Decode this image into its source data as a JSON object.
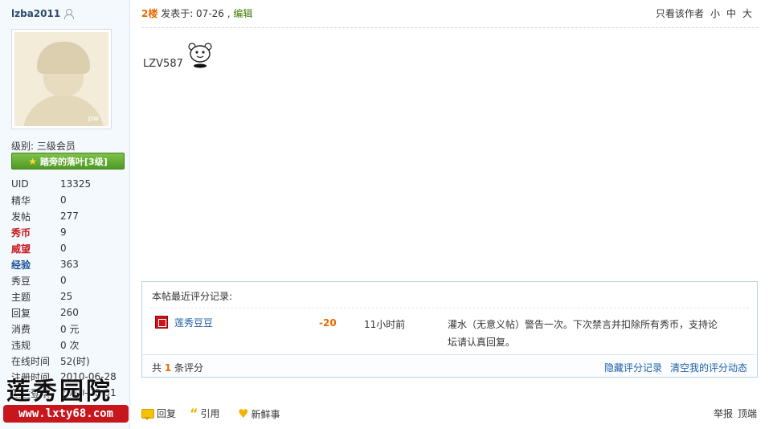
{
  "author": {
    "username": "lzba2011",
    "avatar_tag": "pw",
    "level_label": "级别: 三级会员",
    "level_badge": "踏旁的落叶[3级]",
    "stats": [
      {
        "key": "UID",
        "value": "13325",
        "style": ""
      },
      {
        "key": "精华",
        "value": "0",
        "style": ""
      },
      {
        "key": "发帖",
        "value": "277",
        "style": ""
      },
      {
        "key": "秀币",
        "value": "9",
        "style": "red"
      },
      {
        "key": "威望",
        "value": "0",
        "style": "red"
      },
      {
        "key": "经验",
        "value": "363",
        "style": "blue"
      },
      {
        "key": "秀豆",
        "value": "0",
        "style": ""
      },
      {
        "key": "主题",
        "value": "25",
        "style": ""
      },
      {
        "key": "回复",
        "value": "260",
        "style": ""
      },
      {
        "key": "消费",
        "value": "0 元",
        "style": ""
      },
      {
        "key": "违规",
        "value": "0 次",
        "style": ""
      },
      {
        "key": "在线时间",
        "value": "52(时)",
        "style": ""
      },
      {
        "key": "注册时间",
        "value": "2010-06-28",
        "style": ""
      },
      {
        "key": "最后登录",
        "value": "2010-08-01",
        "style": ""
      }
    ]
  },
  "watermark": {
    "title": "莲秀园院",
    "url": "www.lxty68.com"
  },
  "post": {
    "floor": "2楼",
    "posted_prefix": "发表于: ",
    "posted_date": "07-26",
    "separator": " , ",
    "edit_label": "编辑",
    "only_author": "只看该作者",
    "font_small": "小",
    "font_medium": "中",
    "font_large": "大",
    "content_text": "LZV587"
  },
  "rating": {
    "title": "本帖最近评分记录:",
    "records": [
      {
        "rater": "莲秀豆豆",
        "score": "-20",
        "time": "11小时前",
        "reason": "灌水（无意义帖）警告一次。下次禁言并扣除所有秀币，支持论坛请认真回复。"
      }
    ],
    "count_prefix": "共",
    "count": "1",
    "count_suffix": "条评分",
    "hide_link": "隐藏评分记录",
    "clear_link": "清空我的评分动态"
  },
  "actions": {
    "reply": "回复",
    "quote": "引用",
    "fresh": "新鲜事",
    "report": "举报",
    "top": "顶端"
  }
}
